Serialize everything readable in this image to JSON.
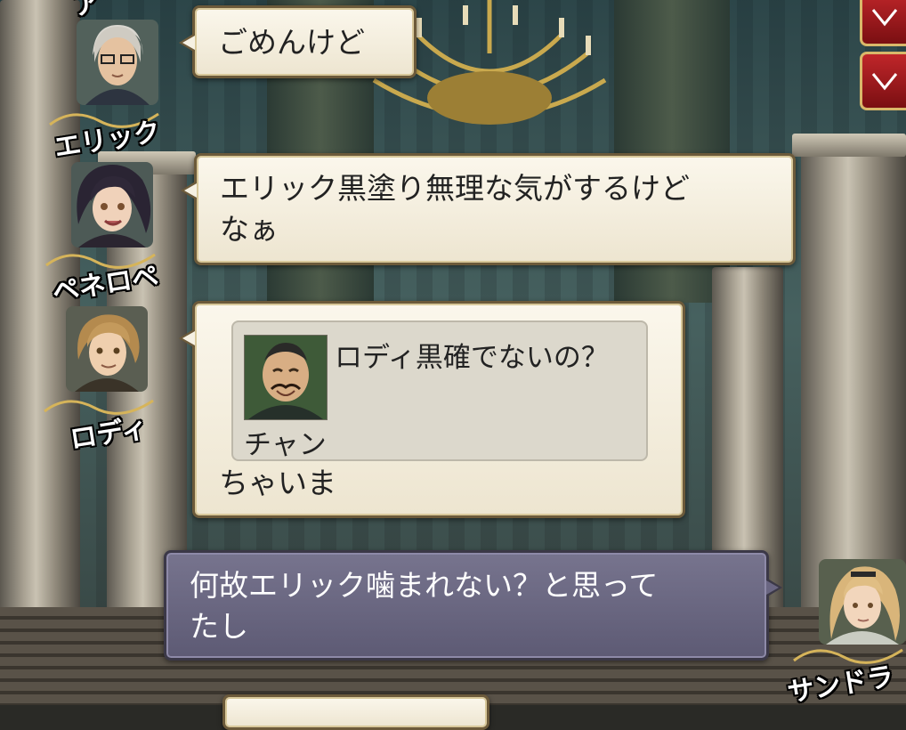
{
  "chat": {
    "messages": [
      {
        "speaker": "エリック",
        "avatar_icon": "eric-portrait-icon",
        "text": "ごめんけど"
      },
      {
        "speaker": "ペネロペ",
        "avatar_icon": "penelope-portrait-icon",
        "text_line1": "エリック黒塗り無理な気がするけど",
        "text_line2": "なぁ"
      },
      {
        "speaker": "ロディ",
        "avatar_icon": "rody-portrait-icon",
        "quote": {
          "speaker": "チャン",
          "avatar_icon": "chan-portrait-icon",
          "text": "ロディ黒確でないの？"
        },
        "text": "ちゃいま"
      },
      {
        "speaker": "サンドラ",
        "avatar_icon": "sandra-portrait-icon",
        "is_self": true,
        "text_line1": "何故エリック噛まれない？と思って",
        "text_line2": "たし"
      }
    ],
    "partial_top_name": "ア",
    "partial_bottom_bubble": ""
  },
  "side_buttons": [
    {
      "icon": "scroll-down-icon"
    },
    {
      "icon": "scroll-down-icon"
    }
  ],
  "colors": {
    "bubble_fill": "#f4efe0",
    "bubble_border": "#6c5a3a",
    "self_bubble_fill": "#6a6682",
    "accent_red": "#b71c1c"
  }
}
